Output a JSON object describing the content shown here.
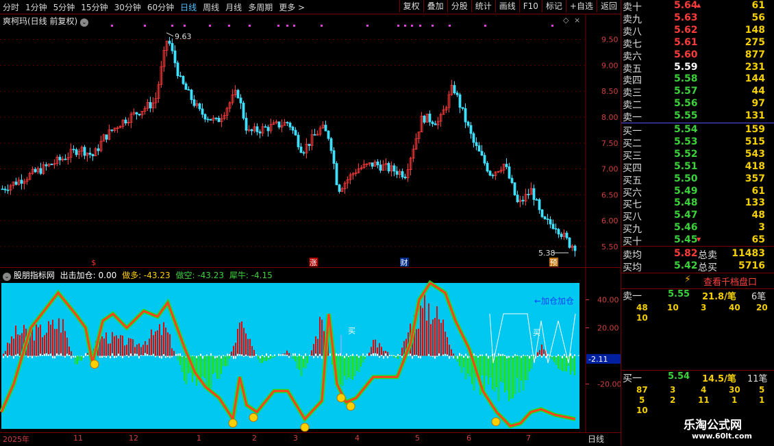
{
  "toolbar": {
    "periods": [
      "分时",
      "1分钟",
      "5分钟",
      "15分钟",
      "30分钟",
      "60分钟",
      "日线",
      "周线",
      "月线",
      "多周期",
      "更多 >"
    ],
    "active_period": "日线",
    "actions": [
      "复权",
      "叠加",
      "分股",
      "统计",
      "画线",
      "F10",
      "标记",
      "+自选",
      "返回"
    ]
  },
  "stock_title": "爽柯玛(日线 前复权)",
  "price_chart": {
    "y_ticks": [
      "9.50",
      "9.00",
      "8.50",
      "8.00",
      "7.50",
      "7.00",
      "6.50",
      "6.00",
      "5.50"
    ],
    "y_values": [
      9.5,
      9.0,
      8.5,
      8.0,
      7.5,
      7.0,
      6.5,
      6.0,
      5.5
    ],
    "high_label": "9.63",
    "low_label": "5.38",
    "event_markers": [
      {
        "text": "$",
        "color": "#ff3030",
        "x": 0.16
      },
      {
        "text": "涨",
        "color": "#ffffff",
        "bg": "#b00000",
        "x": 0.535
      },
      {
        "text": "财",
        "color": "#ffffff",
        "bg": "#002a8a",
        "x": 0.69
      },
      {
        "text": "预",
        "color": "#ffffff",
        "bg": "#c07000",
        "x": 0.945
      }
    ]
  },
  "indicator": {
    "name": "股朋指标网",
    "label_chuji": "出击加仓: 0.00",
    "label_zuoduo": "做多: -43.23",
    "label_zuokong": "做空: -43.23",
    "label_xiniu": "犀牛: -4.15",
    "y_ticks": [
      "40.00",
      "20.00",
      "-20.00"
    ],
    "y_values": [
      40,
      20,
      -20
    ],
    "current_value": "-2.11",
    "annot_buy1": "买",
    "annot_buy2": "买",
    "annot_add": "←加仓加仓"
  },
  "time_axis": {
    "labels": [
      "2025年",
      "11",
      "12",
      "1",
      "2",
      "3",
      "4",
      "5",
      "6",
      "7"
    ],
    "period": "日线"
  },
  "orderbook": {
    "asks": [
      {
        "label": "卖十",
        "price": "5.64",
        "vol": "61",
        "mark": "up"
      },
      {
        "label": "卖九",
        "price": "5.63",
        "vol": "56"
      },
      {
        "label": "卖八",
        "price": "5.62",
        "vol": "148"
      },
      {
        "label": "卖七",
        "price": "5.61",
        "vol": "275"
      },
      {
        "label": "卖六",
        "price": "5.60",
        "vol": "877"
      },
      {
        "label": "卖五",
        "price": "5.59",
        "vol": "231",
        "white": true
      },
      {
        "label": "卖四",
        "price": "5.58",
        "vol": "144"
      },
      {
        "label": "卖三",
        "price": "5.57",
        "vol": "44"
      },
      {
        "label": "卖二",
        "price": "5.56",
        "vol": "97"
      },
      {
        "label": "卖一",
        "price": "5.55",
        "vol": "131"
      }
    ],
    "bids": [
      {
        "label": "买一",
        "price": "5.54",
        "vol": "159"
      },
      {
        "label": "买二",
        "price": "5.53",
        "vol": "515"
      },
      {
        "label": "买三",
        "price": "5.52",
        "vol": "543"
      },
      {
        "label": "买四",
        "price": "5.51",
        "vol": "418"
      },
      {
        "label": "买五",
        "price": "5.50",
        "vol": "357"
      },
      {
        "label": "买六",
        "price": "5.49",
        "vol": "61"
      },
      {
        "label": "买七",
        "price": "5.48",
        "vol": "133"
      },
      {
        "label": "买八",
        "price": "5.47",
        "vol": "48"
      },
      {
        "label": "买九",
        "price": "5.46",
        "vol": "3"
      },
      {
        "label": "买十",
        "price": "5.45",
        "vol": "65",
        "mark": "down"
      }
    ],
    "avg_sell": {
      "label": "卖均",
      "price": "5.82",
      "tlabel": "总卖",
      "total": "11483"
    },
    "avg_buy": {
      "label": "买均",
      "price": "5.42",
      "tlabel": "总买",
      "total": "5716"
    }
  },
  "ten_level_button": "查看千档盘口",
  "level_sell": {
    "label": "卖一",
    "price": "5.55",
    "vol": "21.8/笔",
    "count": "6笔",
    "queue": [
      [
        "48",
        "10",
        "3",
        "40",
        "20"
      ],
      [
        "10"
      ]
    ]
  },
  "level_buy": {
    "label": "买一",
    "price": "5.54",
    "vol": "14.5/笔",
    "count": "11笔",
    "queue": [
      [
        "87",
        "3",
        "4",
        "30",
        "5"
      ],
      [
        "5",
        "2",
        "11",
        "1",
        "1"
      ],
      [
        "10"
      ]
    ]
  },
  "watermark": {
    "line1": "乐淘公式网",
    "line2": "www.60lt.com"
  },
  "colors": {
    "up": "#ff3b3b",
    "down": "#3cd23c",
    "bg_indicator": "#00c8f0",
    "candle_down": "#3fe0ff"
  }
}
